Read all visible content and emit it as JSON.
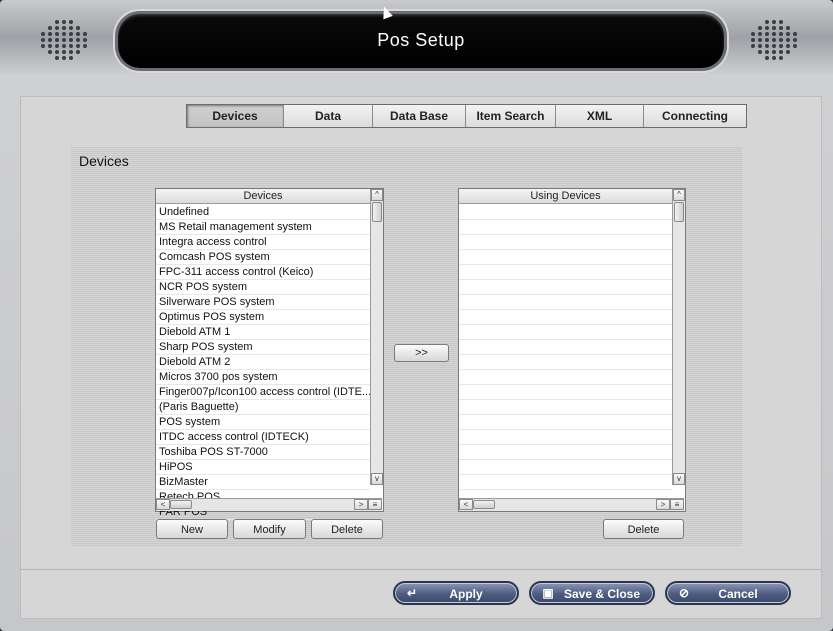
{
  "window": {
    "title": "Pos Setup"
  },
  "tabs": [
    {
      "label": "Devices",
      "active": true
    },
    {
      "label": "Data"
    },
    {
      "label": "Data Base"
    },
    {
      "label": "Item Search"
    },
    {
      "label": "XML"
    },
    {
      "label": "Connecting"
    }
  ],
  "section": {
    "title": "Devices"
  },
  "devices_list": {
    "header": "Devices",
    "items": [
      "Undefined",
      "MS Retail management system",
      "Integra access control",
      "Comcash POS system",
      "FPC-311 access control (Keico)",
      "NCR POS system",
      "Silverware POS system",
      "Optimus POS system",
      "Diebold ATM 1",
      "Sharp POS system",
      "Diebold ATM 2",
      "Micros 3700 pos system",
      "Finger007p/Icon100 access control (IDTE...",
      "(Paris Baguette)",
      "POS system",
      "ITDC access control (IDTECK)",
      "Toshiba POS ST-7000",
      "HiPOS",
      "BizMaster",
      "Retech POS",
      "PAR POS"
    ],
    "buttons": {
      "new": "New",
      "modify": "Modify",
      "delete": "Delete"
    }
  },
  "using_list": {
    "header": "Using Devices",
    "items": [],
    "buttons": {
      "delete": "Delete"
    }
  },
  "transfer_button": ">>",
  "footer": {
    "apply": "Apply",
    "save_close": "Save & Close",
    "cancel": "Cancel"
  },
  "colors": {
    "titlebar": "#000000",
    "pill_button": "#4d5c80"
  }
}
